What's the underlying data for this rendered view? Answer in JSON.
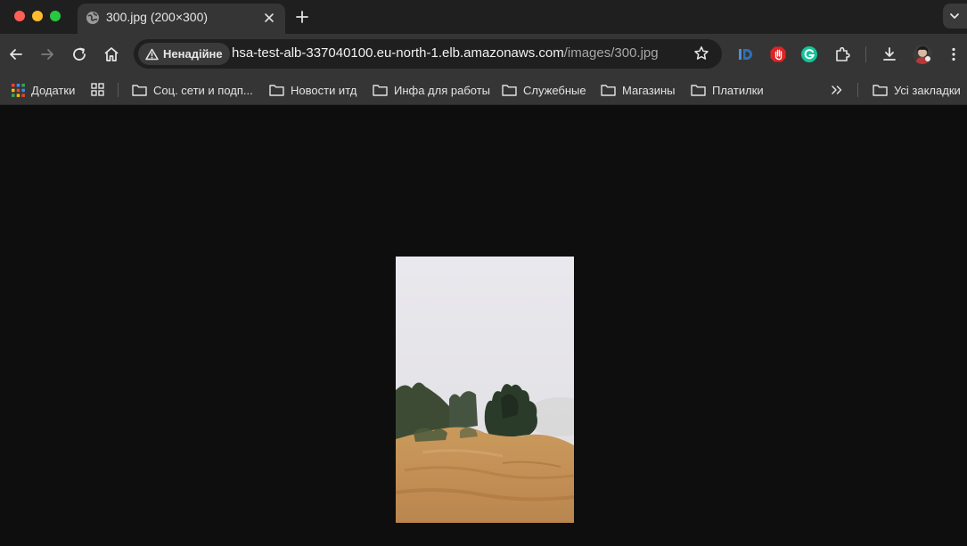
{
  "window_controls": {
    "close_color": "#ff5f57",
    "minimize_color": "#febc2e",
    "maximize_color": "#28c840"
  },
  "tab": {
    "title": "300.jpg (200×300)",
    "favicon": "globe-icon"
  },
  "toolbar": {
    "security_label": "Ненадійне",
    "url_host": "hsa-test-alb-337040100.eu-north-1.elb.amazonaws.com",
    "url_path": "/images/300.jpg",
    "extensions": [
      "id-extension-icon",
      "hand-stop-extension-icon",
      "grammarly-icon",
      "puzzle-extensions-icon"
    ]
  },
  "bookmarks": {
    "apps_label": "Додатки",
    "items": [
      {
        "label": "Соц. сети и подп..."
      },
      {
        "label": "Новости итд"
      },
      {
        "label": "Инфа для работы"
      },
      {
        "label": "Служебные"
      },
      {
        "label": "Магазины"
      },
      {
        "label": "Платилки"
      }
    ],
    "all_bookmarks_label": "Усі закладки"
  },
  "content": {
    "image_description_icon": "photo-hill-trees-fog"
  },
  "colors": {
    "tabstrip_bg": "#1f1f1f",
    "toolbar_bg": "#353535",
    "page_bg": "#0e0e0e"
  }
}
